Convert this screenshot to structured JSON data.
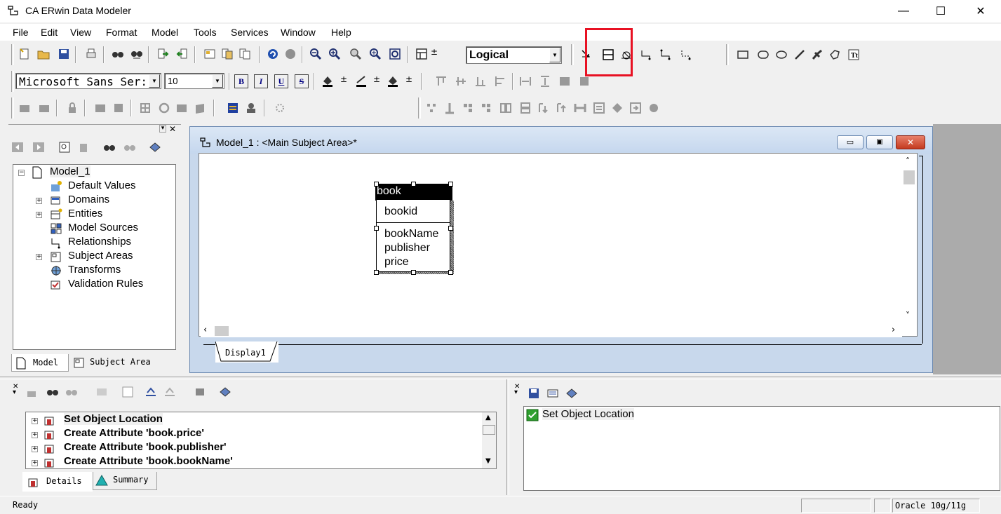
{
  "window": {
    "title": "CA ERwin Data Modeler",
    "minimize": "—",
    "maximize": "☐",
    "close": "✕"
  },
  "menu": [
    "File",
    "Edit",
    "View",
    "Format",
    "Model",
    "Tools",
    "Services",
    "Window",
    "Help"
  ],
  "toolbar": {
    "display_level": "Logical",
    "font_name": "Microsoft Sans Ser:",
    "font_size": "10",
    "bold": "B",
    "italic": "I",
    "underline": "U",
    "strike": "S"
  },
  "model_explorer": {
    "root": "Model_1",
    "items": [
      "Default Values",
      "Domains",
      "Entities",
      "Model Sources",
      "Relationships",
      "Subject Areas",
      "Transforms",
      "Validation Rules"
    ],
    "tabs": [
      "Model",
      "Subject Area"
    ]
  },
  "diagram_window": {
    "title": "Model_1 : <Main Subject Area>*",
    "entity": {
      "name": "book",
      "key": "bookid",
      "attributes": [
        "bookName",
        "publisher",
        "price"
      ]
    },
    "display_tab": "Display1"
  },
  "action_log": {
    "rows": [
      "Set Object Location",
      "Create Attribute 'book.price'",
      "Create Attribute 'book.publisher'",
      "Create Attribute 'book.bookName'"
    ],
    "tabs": [
      "Details",
      "Summary"
    ]
  },
  "transaction_pane": {
    "rows": [
      "Set Object Location"
    ]
  },
  "status": {
    "text": "Ready",
    "database": "Oracle 10g/11g"
  },
  "colors": {
    "highlight_box": "#e81123",
    "title_gradient": "#c5d7ee",
    "entity_header": "#000000"
  }
}
